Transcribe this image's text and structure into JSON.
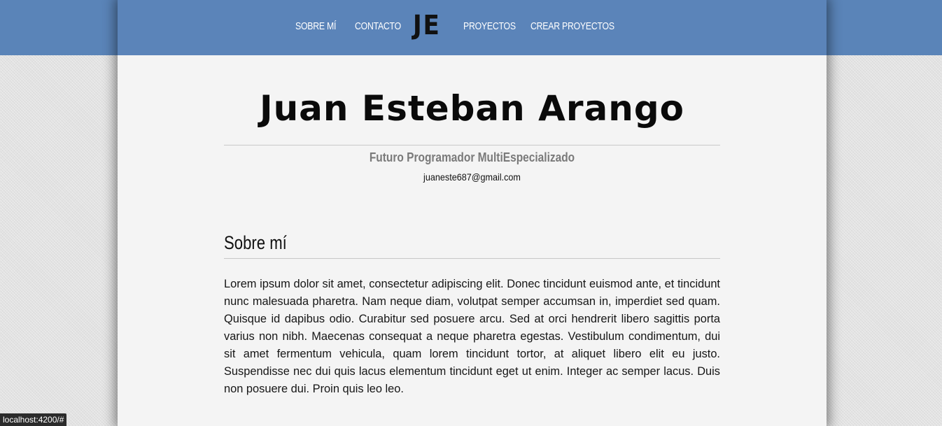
{
  "nav": {
    "items": [
      {
        "label": "SOBRE MÍ"
      },
      {
        "label": "CONTACTO"
      },
      {
        "label": "PROYECTOS"
      },
      {
        "label": "CREAR PROYECTOS"
      }
    ],
    "logo": "JE"
  },
  "profile": {
    "name": "Juan Esteban Arango",
    "tagline": "Futuro Programador MultiEspecializado",
    "email": "juaneste687@gmail.com"
  },
  "about": {
    "title": "Sobre mí",
    "body": "Lorem ipsum dolor sit amet, consectetur adipiscing elit. Donec tincidunt euismod ante, et tincidunt nunc malesuada pharetra. Nam neque diam, volutpat semper accumsan in, imperdiet sed quam. Quisque id dapibus odio. Curabitur sed posuere arcu. Sed at orci hendrerit libero sagittis porta varius non nibh. Maecenas consequat a neque pharetra egestas. Vestibulum condimentum, dui sit amet fermentum vehicula, quam lorem tincidunt tortor, at aliquet libero elit eu justo. Suspendisse nec dui quis lacus elementum tincidunt eget ut enim. Integer ac semper lacus. Duis non posuere dui. Proin quis leo leo."
  },
  "status_bar": {
    "url": "localhost:4200/#"
  },
  "colors": {
    "header": "#5b84b9",
    "page": "#f4f4f4",
    "background": "#e2e2e2"
  }
}
